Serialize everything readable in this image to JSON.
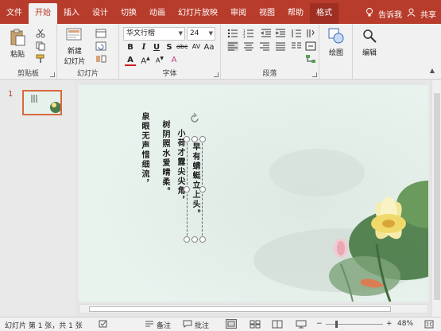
{
  "tabs": [
    "文件",
    "开始",
    "插入",
    "设计",
    "切换",
    "动画",
    "幻灯片放映",
    "审阅",
    "视图",
    "帮助",
    "格式"
  ],
  "active_tab_index": 1,
  "tell_me": "告诉我",
  "share": "共享",
  "ribbon": {
    "clipboard": {
      "paste": "粘贴",
      "label": "剪贴板"
    },
    "slides": {
      "new_slide_line1": "新建",
      "new_slide_line2": "幻灯片",
      "label": "幻灯片"
    },
    "font": {
      "font_name": "华文行楷",
      "font_size": "24",
      "label": "字体"
    },
    "paragraph": {
      "label": "段落"
    },
    "drawing": {
      "label": "绘图"
    },
    "editing": {
      "label": "编辑"
    }
  },
  "thumbnail": {
    "number": "1"
  },
  "slide": {
    "col1": "泉眼无声惜细流，",
    "col2": "树阴照水爱晴柔。",
    "col3": "小荷才露尖尖角，",
    "col4": "早有蜻蜓立上头。"
  },
  "status": {
    "slide_info": "幻灯片 第 1 张，共 1 张",
    "notes": "备注",
    "comments": "批注",
    "zoom": "48%"
  },
  "colors": {
    "accent": "#b83c2b",
    "thumb_border": "#d9683f",
    "slide_bg": "#e9f3ee"
  }
}
